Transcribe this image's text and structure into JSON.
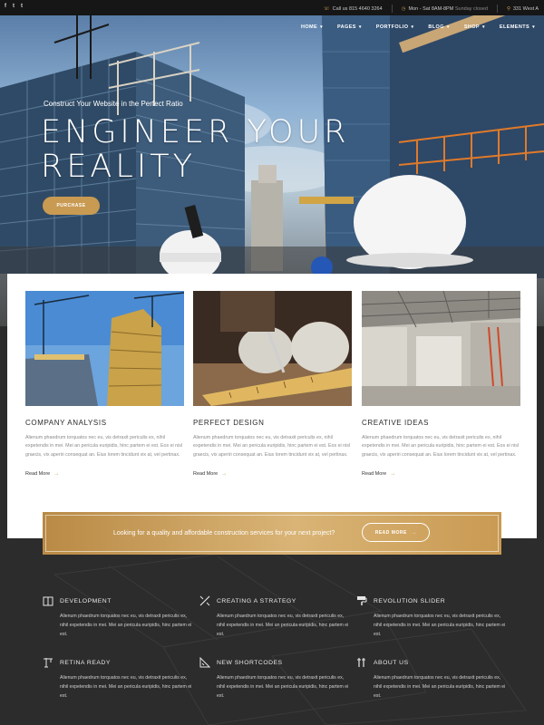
{
  "topbar": {
    "social": [
      "f",
      "t",
      "t"
    ],
    "phone": "Call us 815 4640 3264",
    "hours": "Mon - Sat 8AM-8PM",
    "hours_note": "Sunday closed",
    "address": "331 West A"
  },
  "nav": {
    "items": [
      {
        "label": "HOME"
      },
      {
        "label": "PAGES"
      },
      {
        "label": "PORTFOLIO"
      },
      {
        "label": "BLOG"
      },
      {
        "label": "SHOP"
      },
      {
        "label": "ELEMENTS"
      }
    ]
  },
  "hero": {
    "tagline": "Construct Your Website in the Perfect Ratio",
    "title": "ENGINEER YOUR REALITY",
    "button": "PURCHASE"
  },
  "features": [
    {
      "title": "COMPANY ANALYSIS",
      "text": "Alienum phaedrum torquatos nec eu, vis detraxit periculis ex, nihil expetendis in mei. Mei an pericula euripidis, hinc partem ei est. Eos ei nisl graecis, vix aperiri consequat an. Eius lorem tincidunt vix at, vel pertinax.",
      "more": "Read More"
    },
    {
      "title": "PERFECT DESIGN",
      "text": "Alienum phaedrum torquatos nec eu, vis detraxit periculis ex, nihil expetendis in mei. Mei an pericula euripidis, hinc partem ei est. Eos ei nisl graecis, vix aperiri consequat an. Eius lorem tincidunt vix at, vel pertinax.",
      "more": "Read More"
    },
    {
      "title": "CREATIVE IDEAS",
      "text": "Alienum phaedrum torquatos nec eu, vis detraxit periculis ex, nihil expetendis in mei. Mei an pericula euripidis, hinc partem ei est. Eos ei nisl graecis, vix aperiri consequat an. Eius lorem tincidunt vix at, vel pertinax.",
      "more": "Read More"
    }
  ],
  "cta": {
    "text": "Looking for a quality and affordable construction services for your next project?",
    "button": "READ MORE"
  },
  "services": [
    {
      "title": "DEVELOPMENT",
      "icon": "building-icon",
      "text": "Alienum phaedrum torquatos nec eu, vis detraxit periculis ex, nihil expetendis in mei. Mei an pericula euripidis, hinc partem ei est."
    },
    {
      "title": "CREATING A STRATEGY",
      "icon": "pencil-ruler-icon",
      "text": "Alienum phaedrum torquatos nec eu, vis detraxit periculis ex, nihil expetendis in mei. Mei an pericula euripidis, hinc partem ei est."
    },
    {
      "title": "REVOLUTION SLIDER",
      "icon": "paint-roller-icon",
      "text": "Alienum phaedrum torquatos nec eu, vis detraxit periculis ex, nihil expetendis in mei. Mei an pericula euripidis, hinc partem ei est."
    },
    {
      "title": "RETINA READY",
      "icon": "crane-icon",
      "text": "Alienum phaedrum torquatos nec eu, vis detraxit periculis ex, nihil expetendis in mei. Mei an pericula euripidis, hinc partem ei est."
    },
    {
      "title": "NEW SHORTCODES",
      "icon": "ruler-triangle-icon",
      "text": "Alienum phaedrum torquatos nec eu, vis detraxit periculis ex, nihil expetendis in mei. Mei an pericula euripidis, hinc partem ei est."
    },
    {
      "title": "ABOUT US",
      "icon": "tools-icon",
      "text": "Alienum phaedrum torquatos nec eu, vis detraxit periculis ex, nihil expetendis in mei. Mei an pericula euripidis, hinc partem ei est."
    }
  ],
  "colors": {
    "accent": "#c99a52",
    "dark": "#2c2c2c",
    "topbar": "#161616"
  }
}
